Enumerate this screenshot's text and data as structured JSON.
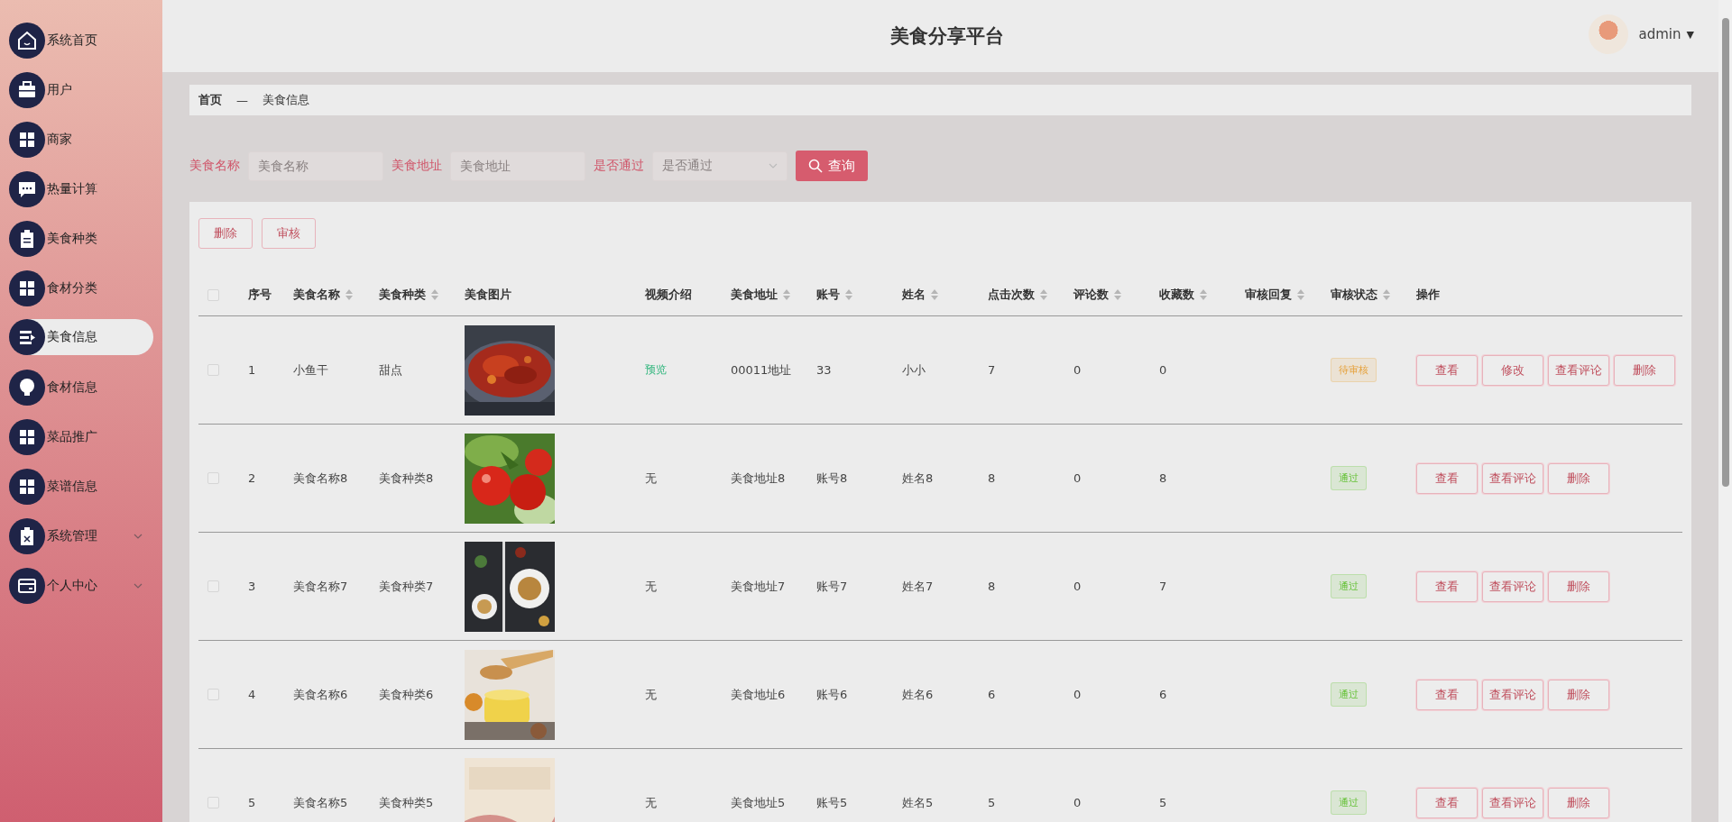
{
  "sidebar": {
    "items": [
      {
        "label": "系统首页",
        "selected": false,
        "kind": "link"
      },
      {
        "label": "用户",
        "selected": false,
        "kind": "link"
      },
      {
        "label": "商家",
        "selected": false,
        "kind": "link"
      },
      {
        "label": "热量计算",
        "selected": false,
        "kind": "link"
      },
      {
        "label": "美食种类",
        "selected": false,
        "kind": "link"
      },
      {
        "label": "食材分类",
        "selected": false,
        "kind": "link"
      },
      {
        "label": "美食信息",
        "selected": true,
        "kind": "link"
      },
      {
        "label": "食材信息",
        "selected": false,
        "kind": "link"
      },
      {
        "label": "菜品推广",
        "selected": false,
        "kind": "link"
      },
      {
        "label": "菜谱信息",
        "selected": false,
        "kind": "link"
      },
      {
        "label": "系统管理",
        "selected": false,
        "kind": "menu"
      },
      {
        "label": "个人中心",
        "selected": false,
        "kind": "menu"
      }
    ]
  },
  "header": {
    "title": "美食分享平台",
    "user": "admin",
    "menu_icon": "▼"
  },
  "breadcrumb": [
    "首页",
    "—",
    "美食信息"
  ],
  "search": {
    "fields": [
      {
        "label": "美食名称",
        "placeholder": "美食名称",
        "kind": "input"
      },
      {
        "label": "美食地址",
        "placeholder": "美食地址",
        "kind": "input"
      },
      {
        "label": "是否通过",
        "placeholder": "是否通过",
        "kind": "select"
      }
    ],
    "button": "查询"
  },
  "toolbar": [
    "删除",
    "审核"
  ],
  "table": {
    "all_checked": false,
    "columns": [
      {
        "label": "序号",
        "sortable": false
      },
      {
        "label": "美食名称",
        "sortable": true
      },
      {
        "label": "美食种类",
        "sortable": true
      },
      {
        "label": "美食图片",
        "sortable": false
      },
      {
        "label": "视频介绍",
        "sortable": false
      },
      {
        "label": "美食地址",
        "sortable": true
      },
      {
        "label": "账号",
        "sortable": true
      },
      {
        "label": "姓名",
        "sortable": true
      },
      {
        "label": "点击次数",
        "sortable": true
      },
      {
        "label": "评论数",
        "sortable": true
      },
      {
        "label": "收藏数",
        "sortable": true
      },
      {
        "label": "审核回复",
        "sortable": true
      },
      {
        "label": "审核状态",
        "sortable": true
      },
      {
        "label": "操作",
        "sortable": false
      }
    ],
    "rows": [
      {
        "checked": false,
        "index": "1",
        "name": "小鱼干",
        "category": "甜点",
        "image": {
          "kind": "picture"
        },
        "video": {
          "text": "预览",
          "kind": "link"
        },
        "address": "00011地址",
        "account": "33",
        "person": "小小",
        "clicks": "7",
        "comments": "0",
        "favorites": "0",
        "status": {
          "text": "待审核",
          "color": "#e6a23c"
        },
        "actions": [
          "查看",
          "修改",
          "查看评论",
          "删除"
        ]
      },
      {
        "checked": false,
        "index": "2",
        "name": "美食名称8",
        "category": "美食种类8",
        "image": {
          "kind": "picture"
        },
        "video": {
          "text": "无",
          "kind": "text"
        },
        "address": "美食地址8",
        "account": "账号8",
        "person": "姓名8",
        "clicks": "8",
        "comments": "0",
        "favorites": "8",
        "status": {
          "text": "通过",
          "color": "#67c23a"
        },
        "actions": [
          "查看",
          "查看评论",
          "删除"
        ]
      },
      {
        "checked": false,
        "index": "3",
        "name": "美食名称7",
        "category": "美食种类7",
        "image": {
          "kind": "picture"
        },
        "video": {
          "text": "无",
          "kind": "text"
        },
        "address": "美食地址7",
        "account": "账号7",
        "person": "姓名7",
        "clicks": "8",
        "comments": "0",
        "favorites": "7",
        "status": {
          "text": "通过",
          "color": "#67c23a"
        },
        "actions": [
          "查看",
          "查看评论",
          "删除"
        ]
      },
      {
        "checked": false,
        "index": "4",
        "name": "美食名称6",
        "category": "美食种类6",
        "image": {
          "kind": "picture"
        },
        "video": {
          "text": "无",
          "kind": "text"
        },
        "address": "美食地址6",
        "account": "账号6",
        "person": "姓名6",
        "clicks": "6",
        "comments": "0",
        "favorites": "6",
        "status": {
          "text": "通过",
          "color": "#67c23a"
        },
        "actions": [
          "查看",
          "查看评论",
          "删除"
        ]
      },
      {
        "checked": false,
        "index": "5",
        "name": "美食名称5",
        "category": "美食种类5",
        "image": {
          "kind": "picture"
        },
        "video": {
          "text": "无",
          "kind": "text"
        },
        "address": "美食地址5",
        "account": "账号5",
        "person": "姓名5",
        "clicks": "5",
        "comments": "0",
        "favorites": "5",
        "status": {
          "text": "通过",
          "color": "#67c23a"
        },
        "actions": [
          "查看",
          "查看评论",
          "删除"
        ]
      }
    ]
  }
}
